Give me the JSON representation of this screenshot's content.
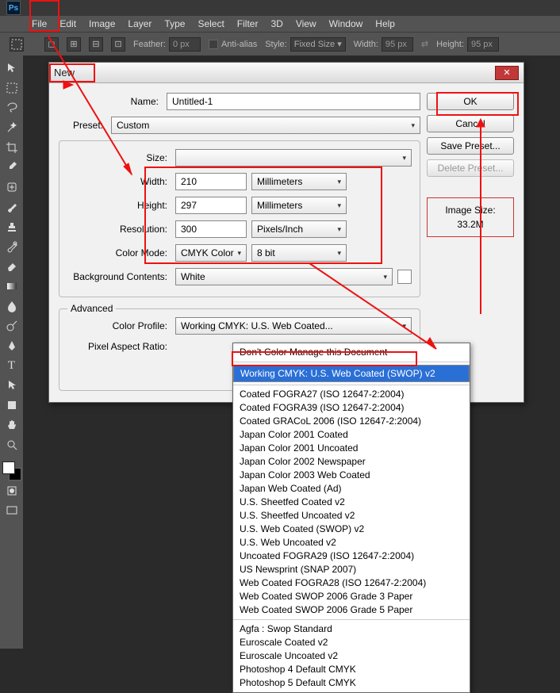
{
  "menubar": [
    "File",
    "Edit",
    "Image",
    "Layer",
    "Type",
    "Select",
    "Filter",
    "3D",
    "View",
    "Window",
    "Help"
  ],
  "options": {
    "feather_label": "Feather:",
    "feather_value": "0 px",
    "antialias_label": "Anti-alias",
    "style_label": "Style:",
    "style_value": "Fixed Size",
    "width_label": "Width:",
    "width_value": "95 px",
    "height_label": "Height:",
    "height_value": "95 px"
  },
  "dialog": {
    "title": "New",
    "name_label": "Name:",
    "name_value": "Untitled-1",
    "preset_label": "Preset:",
    "preset_value": "Custom",
    "size_label": "Size:",
    "size_value": "",
    "width_label": "Width:",
    "width_value": "210",
    "width_unit": "Millimeters",
    "height_label": "Height:",
    "height_value": "297",
    "height_unit": "Millimeters",
    "resolution_label": "Resolution:",
    "resolution_value": "300",
    "resolution_unit": "Pixels/Inch",
    "colormode_label": "Color Mode:",
    "colormode_value": "CMYK Color",
    "colormode_bits": "8 bit",
    "bgcontents_label": "Background Contents:",
    "bgcontents_value": "White",
    "advanced_label": "Advanced",
    "colorprofile_label": "Color Profile:",
    "colorprofile_value": "Working CMYK:  U.S. Web Coated...",
    "pixelaspect_label": "Pixel Aspect Ratio:",
    "buttons": {
      "ok": "OK",
      "cancel": "Cancel",
      "savepreset": "Save Preset...",
      "deletepreset": "Delete Preset..."
    },
    "image_size_label": "Image Size:",
    "image_size_value": "33.2M"
  },
  "colorprofile_options": {
    "group0": [
      "Don't Color Manage this Document"
    ],
    "group1": [
      "Working CMYK:  U.S. Web Coated (SWOP) v2"
    ],
    "group2": [
      "Coated FOGRA27 (ISO 12647-2:2004)",
      "Coated FOGRA39 (ISO 12647-2:2004)",
      "Coated GRACoL 2006 (ISO 12647-2:2004)",
      "Japan Color 2001 Coated",
      "Japan Color 2001 Uncoated",
      "Japan Color 2002 Newspaper",
      "Japan Color 2003 Web Coated",
      "Japan Web Coated (Ad)",
      "U.S. Sheetfed Coated v2",
      "U.S. Sheetfed Uncoated v2",
      "U.S. Web Coated (SWOP) v2",
      "U.S. Web Uncoated v2",
      "Uncoated FOGRA29 (ISO 12647-2:2004)",
      "US Newsprint (SNAP 2007)",
      "Web Coated FOGRA28 (ISO 12647-2:2004)",
      "Web Coated SWOP 2006 Grade 3 Paper",
      "Web Coated SWOP 2006 Grade 5 Paper"
    ],
    "group3": [
      "Agfa : Swop Standard",
      "Euroscale Coated v2",
      "Euroscale Uncoated v2",
      "Photoshop 4 Default CMYK",
      "Photoshop 5 Default CMYK"
    ]
  }
}
